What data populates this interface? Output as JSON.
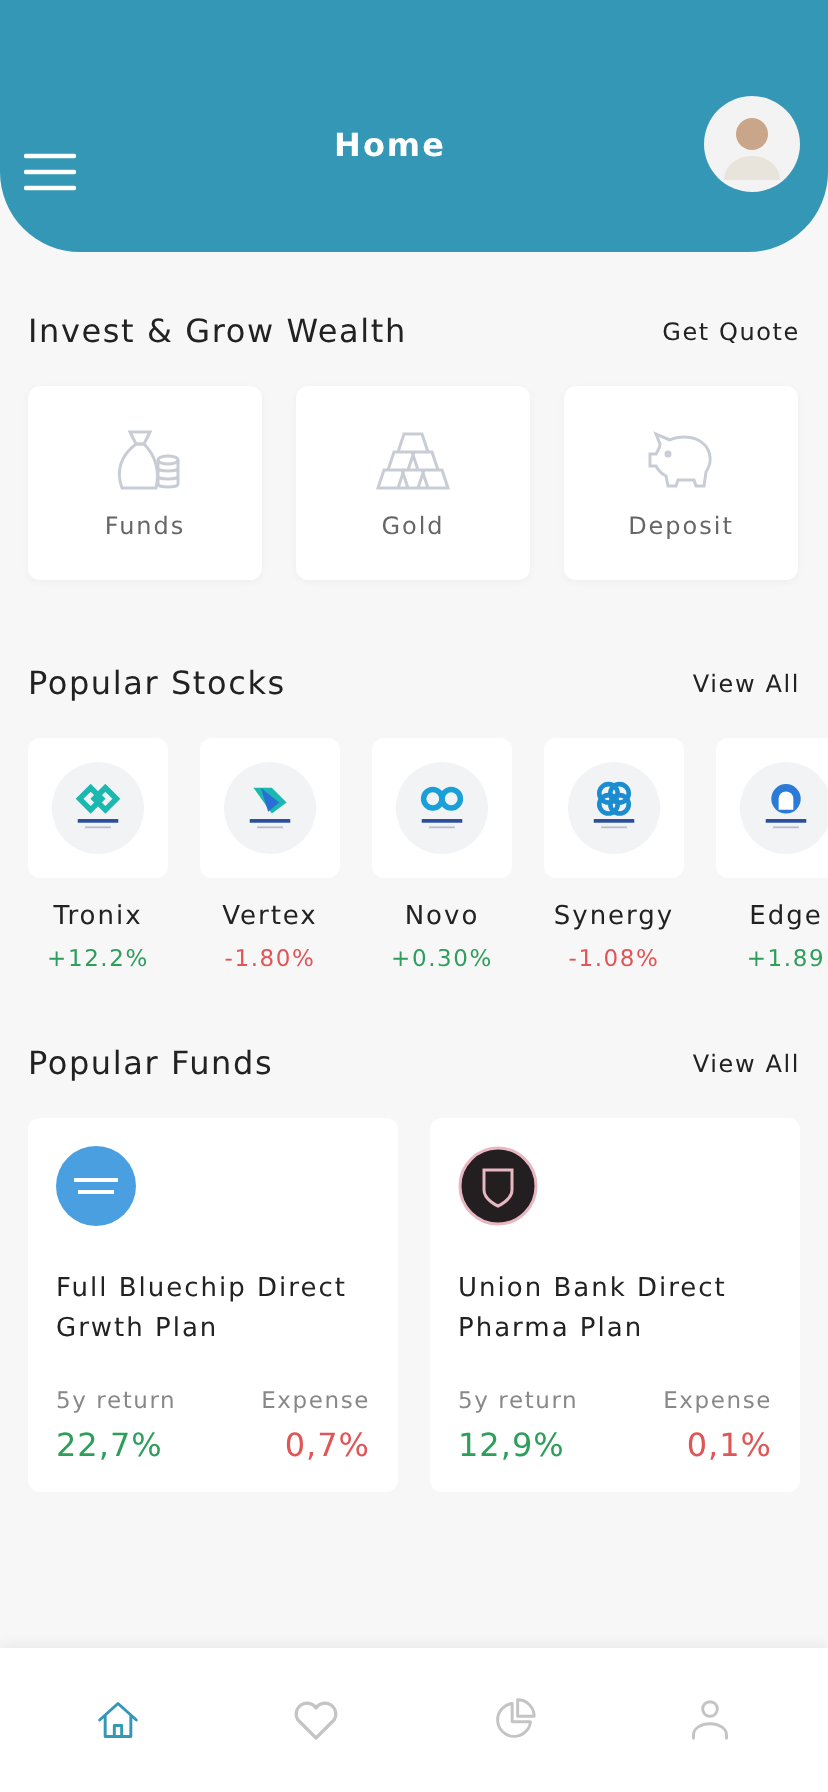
{
  "header": {
    "title": "Home"
  },
  "invest": {
    "title": "Invest & Grow Wealth",
    "action": "Get Quote",
    "options": [
      {
        "kind": "funds",
        "label": "Funds"
      },
      {
        "kind": "gold",
        "label": "Gold"
      },
      {
        "kind": "deposit",
        "label": "Deposit"
      }
    ]
  },
  "stocks": {
    "title": "Popular Stocks",
    "action": "View All",
    "items": [
      {
        "kind": "diamond",
        "name": "Tronix",
        "change": "+12.2%",
        "rising": true
      },
      {
        "kind": "arrow",
        "name": "Vertex",
        "change": "-1.80%",
        "rising": false
      },
      {
        "kind": "infinity",
        "name": "Novo",
        "change": "+0.30%",
        "rising": true
      },
      {
        "kind": "rings",
        "name": "Synergy",
        "change": "-1.08%",
        "rising": false
      },
      {
        "kind": "arch",
        "name": "Edge",
        "change": "+1.89",
        "rising": true
      }
    ]
  },
  "funds": {
    "title": "Popular Funds",
    "action": "View All",
    "items": [
      {
        "kind": "round",
        "name": "Full Bluechip Direct Grwth Plan",
        "return_label": "5y return",
        "return": "22,7%",
        "expense_label": "Expense",
        "expense": "0,7%"
      },
      {
        "kind": "crest",
        "name": "Union Bank Direct Pharma Plan",
        "return_label": "5y return",
        "return": "12,9%",
        "expense_label": "Expense",
        "expense": "0,1%"
      }
    ]
  },
  "nav": [
    {
      "kind": "home",
      "selected": true
    },
    {
      "kind": "heart",
      "selected": false
    },
    {
      "kind": "chart",
      "selected": false
    },
    {
      "kind": "user",
      "selected": false
    }
  ]
}
